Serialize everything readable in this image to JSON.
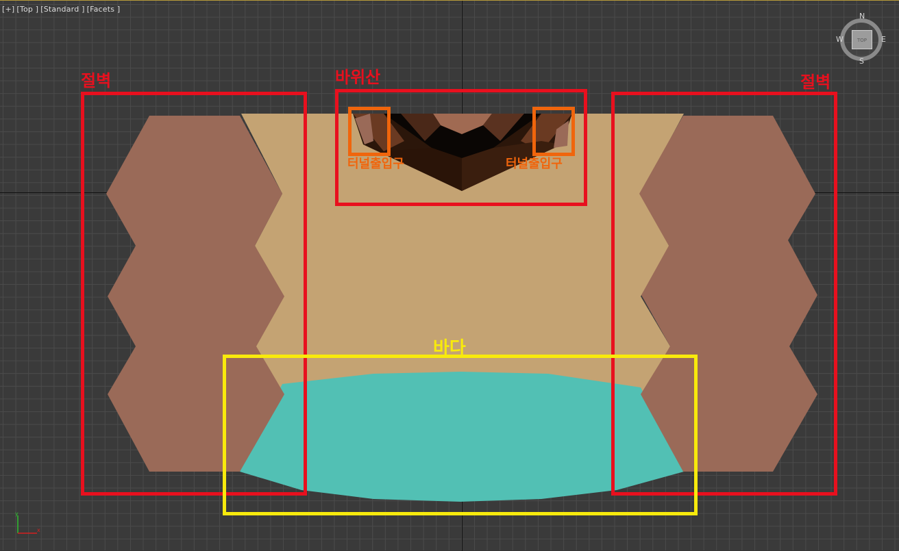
{
  "viewport": {
    "label_parts": [
      "[+]",
      "[Top ]",
      "[Standard ]",
      "[Facets ]"
    ]
  },
  "annotations": {
    "cliff_left": "절벽",
    "rock_mountain": "바위산",
    "cliff_right": "절벽",
    "tunnel_left": "터널출입구",
    "tunnel_right": "터널출입구",
    "sea": "바다"
  },
  "viewcube": {
    "face": "TOP",
    "north": "N",
    "south": "S",
    "east": "E",
    "west": "W"
  },
  "axis_tripod": {
    "x": "x",
    "y": "y"
  },
  "colors": {
    "background": "#3a3a3a",
    "grid": "#4b4b4b",
    "sand": "#c4a373",
    "cliff": "#9a6a58",
    "sea": "#52c0b4",
    "annotation_red": "#e8101e",
    "annotation_orange": "#f0650c",
    "annotation_yellow": "#f8ea0c"
  }
}
